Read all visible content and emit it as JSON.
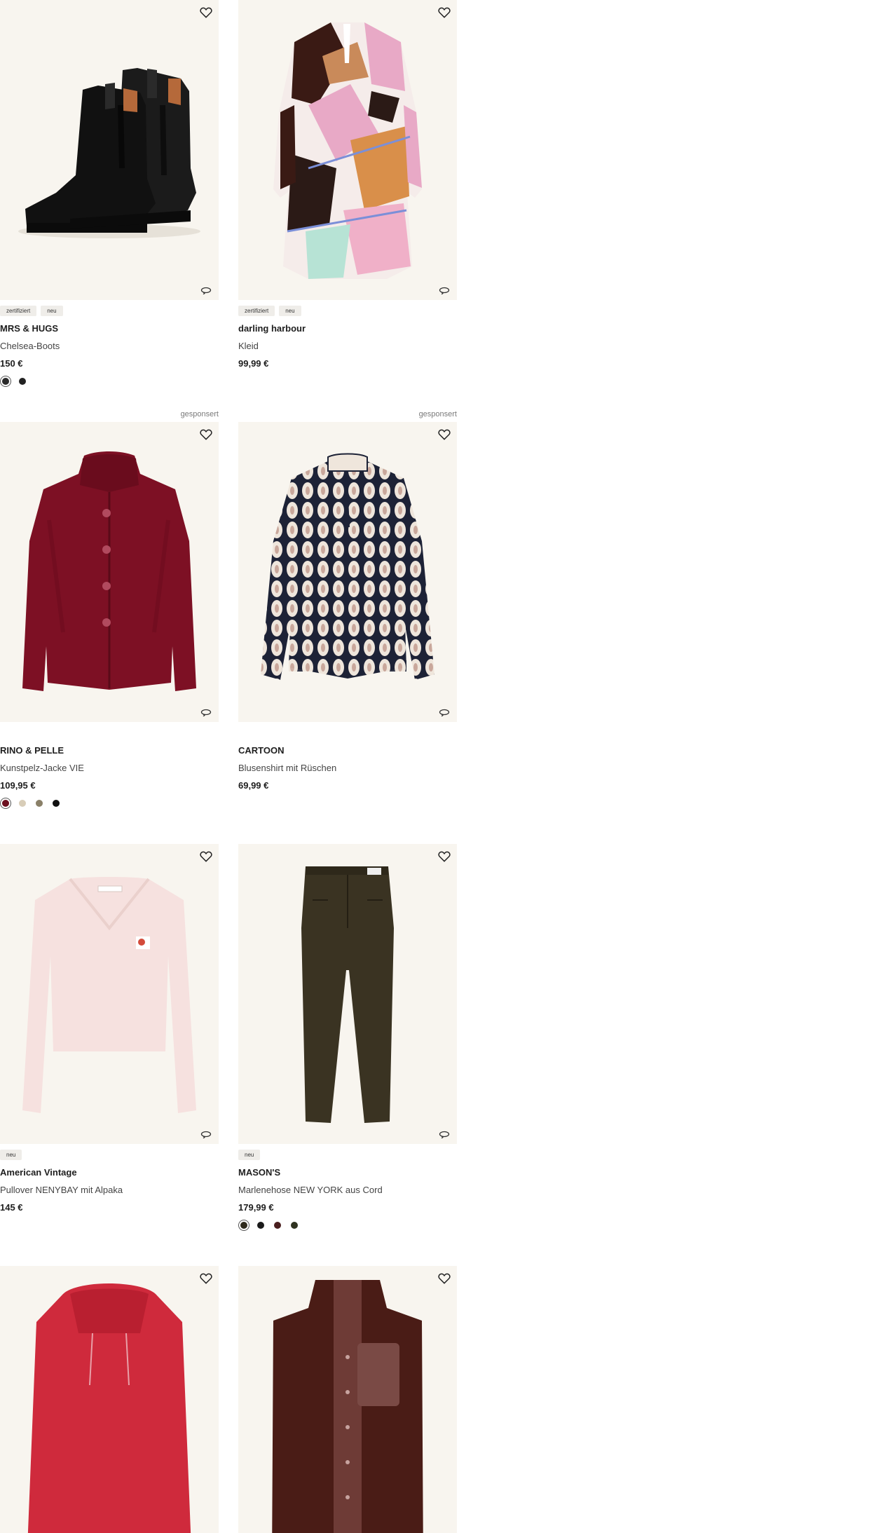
{
  "products": [
    {
      "brand": "MRS & HUGS",
      "name": "Chelsea-Boots",
      "price": "150 €",
      "badges": [
        "zertifiziert",
        "neu"
      ],
      "sponsored": "",
      "swatches": [
        "#2b2b2b",
        "#222222"
      ]
    },
    {
      "brand": "darling harbour",
      "name": "Kleid",
      "price": "99,99 €",
      "badges": [
        "zertifiziert",
        "neu"
      ],
      "sponsored": "",
      "swatches": []
    },
    {
      "brand": "RINO & PELLE",
      "name": "Kunstpelz-Jacke VIE",
      "price": "109,95 €",
      "badges": [],
      "sponsored": "gesponsert",
      "swatches": [
        "#6b0f1f",
        "#d8cdb8",
        "#8a8068",
        "#111111"
      ]
    },
    {
      "brand": "CARTOON",
      "name": "Blusenshirt mit Rüschen",
      "price": "69,99 €",
      "badges": [],
      "sponsored": "gesponsert",
      "swatches": []
    },
    {
      "brand": "American Vintage",
      "name": "Pullover NENYBAY mit Alpaka",
      "price": "145 €",
      "badges": [
        "neu"
      ],
      "sponsored": "",
      "swatches": []
    },
    {
      "brand": "MASON'S",
      "name": "Marlenehose NEW YORK aus Cord",
      "price": "179,99 €",
      "badges": [
        "neu"
      ],
      "sponsored": "",
      "swatches": [
        "#2e2a1c",
        "#1a1a1a",
        "#4a1f1f",
        "#2f3320"
      ]
    },
    {
      "brand": "",
      "name": "",
      "price": "",
      "badges": [],
      "sponsored": "",
      "swatches": []
    },
    {
      "brand": "",
      "name": "",
      "price": "",
      "badges": [],
      "sponsored": "",
      "swatches": []
    }
  ],
  "icons": {
    "wishlist": "heart-icon",
    "view": "360-view-icon"
  }
}
